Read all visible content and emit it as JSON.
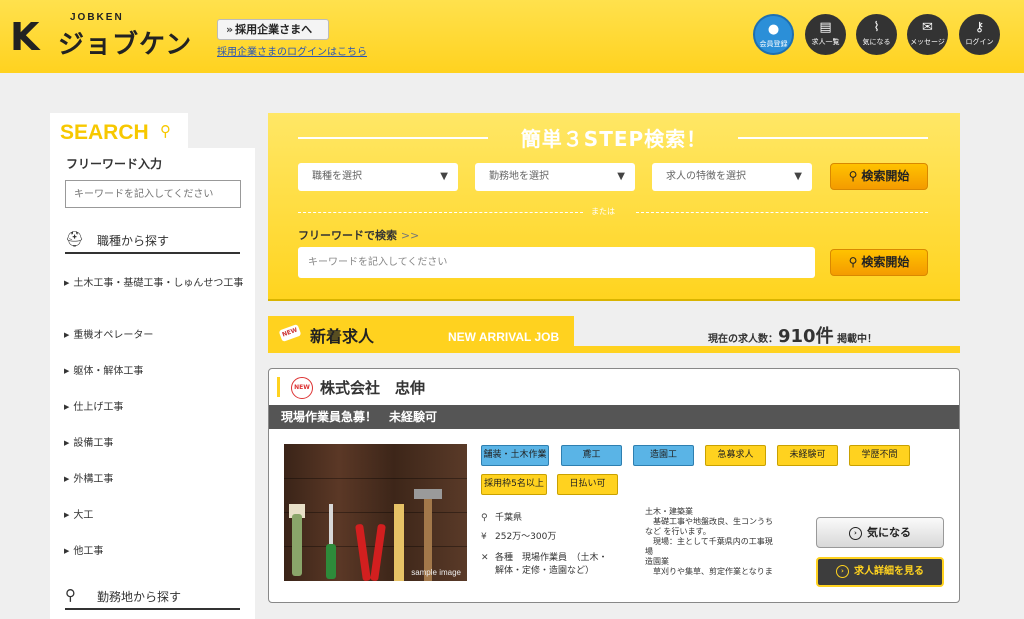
{
  "header": {
    "logo_sub": "JOBKEN",
    "logo_k": "K",
    "logo_main": "ジョブケン",
    "corp_button": "採用企業さまへ",
    "corp_login": "採用企業さまのログインはこちら",
    "icons": [
      {
        "icon": "person-icon",
        "glyph": "👤",
        "label": "会員登録",
        "color": "#2b8fd8"
      },
      {
        "icon": "list-icon",
        "glyph": "▤",
        "label": "求人一覧",
        "color": "#333333"
      },
      {
        "icon": "clip-icon",
        "glyph": "⌇",
        "label": "気になる",
        "color": "#333333"
      },
      {
        "icon": "mail-icon",
        "glyph": "✉",
        "label": "メッセージ",
        "color": "#333333"
      },
      {
        "icon": "key-icon",
        "glyph": "⚷",
        "label": "ログイン",
        "color": "#333333"
      }
    ]
  },
  "sidebar": {
    "title": "SEARCH",
    "freeword_label": "フリーワード入力",
    "freeword_placeholder": "キーワードを記入してください",
    "section_job": "職種から探す",
    "job_items": [
      "土木工事・基礎工事・しゅんせつ工事",
      "重機オペレーター",
      "躯体・解体工事",
      "仕上げ工事",
      "設備工事",
      "外構工事",
      "大工",
      "他工事"
    ],
    "section_area": "勤務地から探す"
  },
  "search_panel": {
    "title": "簡単３STEP検索！",
    "select_job": "職種を選択",
    "select_area": "勤務地を選択",
    "select_feature": "求人の特徴を選択",
    "search_button": "検索開始",
    "or_text": "または",
    "freeword_label": "フリーワードで検索",
    "freeword_chevron": ">>",
    "freeword_placeholder": "キーワードを記入してください"
  },
  "new_arrivals": {
    "badge": "NEW",
    "title": "新着求人",
    "title_en": "NEW ARRIVAL JOB",
    "count_prefix": "現在の求人数：",
    "count": "910件",
    "count_suffix": "掲載中！"
  },
  "job": {
    "new_badge": "NEW",
    "company": "株式会社　忠伸",
    "headline": "現場作業員急募！　未経験可",
    "photo_watermark": "sample image",
    "tags": [
      {
        "label": "舗装・土木作業",
        "style": "blue"
      },
      {
        "label": "鳶工",
        "style": "blue"
      },
      {
        "label": "造園工",
        "style": "blue"
      },
      {
        "label": "急募求人",
        "style": "yellow"
      },
      {
        "label": "未経験可",
        "style": "yellow"
      },
      {
        "label": "学歴不問",
        "style": "yellow"
      },
      {
        "label": "採用枠5名以上",
        "style": "yellow"
      },
      {
        "label": "日払い可",
        "style": "yellow"
      }
    ],
    "location": "千葉県",
    "salary": "252万～300万",
    "occupation_line1": "各種　現場作業員　（土木・",
    "occupation_line2": "解体・定修・造園など）",
    "desc_lines": [
      "土木・建築業",
      "　基礎工事や地盤改良、生コンうち",
      "など を行います。",
      "　現場：主として千葉県内の工事現",
      "場",
      "造園業",
      "　草刈りや集草、剪定作業となりま"
    ],
    "fav_button": "気になる",
    "detail_button": "求人詳細を見る"
  }
}
